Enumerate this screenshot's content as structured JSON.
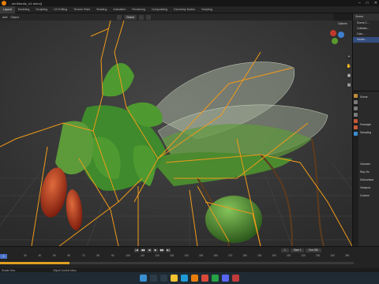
{
  "window": {
    "title": "…der\\Mantis_A1.blend]"
  },
  "workspace_tabs": [
    "Layout",
    "Modeling",
    "Sculpting",
    "UV Editing",
    "Texture Paint",
    "Shading",
    "Animation",
    "Rendering",
    "Compositing",
    "Geometry Nodes",
    "Scripting"
  ],
  "header": {
    "mode": "Add",
    "object": "Object",
    "transform": "Global",
    "options": "Options"
  },
  "outliner": {
    "title": "Scene",
    "rows": [
      "Scene C…",
      "Collectio…",
      "Cam…",
      "Mantis…"
    ]
  },
  "properties": {
    "scene_label": "Scene",
    "rows": [
      "Scene",
      "Freestyle",
      "Sampling",
      "Volumes",
      "Ray Vis",
      "Subsurface",
      "Viewport",
      "Custom"
    ]
  },
  "timeline": {
    "current_frame": "1",
    "start_label": "Start",
    "start": "1",
    "end_label": "End",
    "end": "250",
    "ticks": [
      "30",
      "40",
      "50",
      "60",
      "70",
      "80",
      "90",
      "100",
      "110",
      "120",
      "130",
      "140",
      "150",
      "160",
      "170",
      "180",
      "190",
      "200",
      "210",
      "220",
      "230",
      "240",
      "250"
    ]
  },
  "statusbar": {
    "left": "Rotate View",
    "right": "Object Context Menu"
  },
  "tray": {
    "time": "",
    "lang": ""
  },
  "colors": {
    "bone": "#f09a1a",
    "leaf": "#3f8a2c",
    "body_red": "#c0391b",
    "wing": "#a9b9a0",
    "accent": "#4a73c9"
  }
}
